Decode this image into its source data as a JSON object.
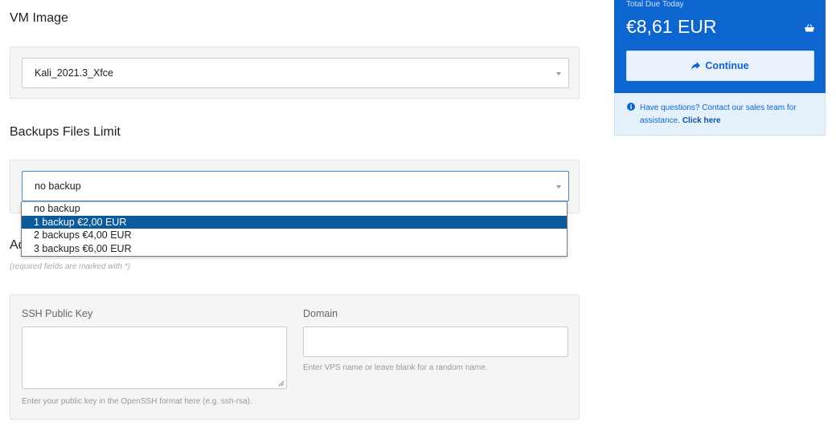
{
  "vm_image": {
    "heading": "VM Image",
    "selected": "Kali_2021.3_Xfce"
  },
  "backups": {
    "heading": "Backups Files Limit",
    "selected": "no backup",
    "options": [
      {
        "label": "no backup",
        "highlighted": false
      },
      {
        "label": "1 backup €2,00 EUR",
        "highlighted": true
      },
      {
        "label": "2 backups €4,00 EUR",
        "highlighted": false
      },
      {
        "label": "3 backups €6,00 EUR",
        "highlighted": false
      }
    ]
  },
  "additional": {
    "heading_visible": "Ad",
    "required_note": "(required fields are marked with *)",
    "ssh": {
      "label": "SSH Public Key",
      "value": "",
      "help": "Enter your public key in the OpenSSH format here (e.g. ssh-rsa)."
    },
    "domain": {
      "label": "Domain",
      "value": "",
      "help": "Enter VPS name or leave blank for a random name."
    }
  },
  "summary": {
    "total_label": "Total Due Today",
    "total_amount": "€8,61 EUR",
    "continue_label": "Continue",
    "info_text": "Have questions? Contact our sales team for assistance.",
    "info_link": "Click here"
  },
  "colors": {
    "primary": "#0d66d0",
    "selected_option": "#0a5a9c",
    "panel_bg": "#f5f5f5"
  },
  "icons": {
    "basket": "basket-icon",
    "continue": "arrow-right-icon",
    "info": "info-circle-icon",
    "caret": "caret-down-icon"
  }
}
